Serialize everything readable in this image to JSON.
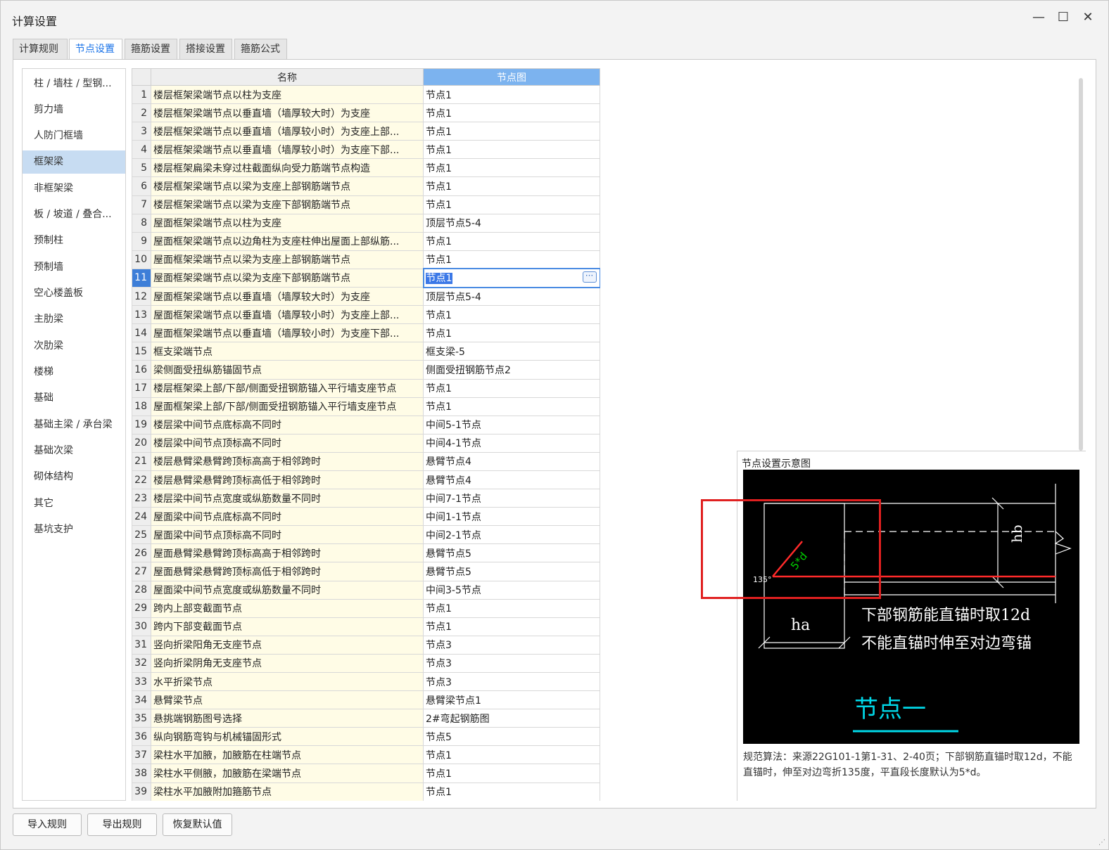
{
  "window": {
    "title": "计算设置"
  },
  "tabs": [
    {
      "label": "计算规则"
    },
    {
      "label": "节点设置"
    },
    {
      "label": "箍筋设置"
    },
    {
      "label": "搭接设置"
    },
    {
      "label": "箍筋公式"
    }
  ],
  "sidebar": {
    "items": [
      {
        "label": "柱 / 墙柱 / 型钢..."
      },
      {
        "label": "剪力墙"
      },
      {
        "label": "人防门框墙"
      },
      {
        "label": "框架梁"
      },
      {
        "label": "非框架梁"
      },
      {
        "label": "板 / 坡道 / 叠合..."
      },
      {
        "label": "预制柱"
      },
      {
        "label": "预制墙"
      },
      {
        "label": "空心楼盖板"
      },
      {
        "label": "主肋梁"
      },
      {
        "label": "次肋梁"
      },
      {
        "label": "楼梯"
      },
      {
        "label": "基础"
      },
      {
        "label": "基础主梁 / 承台梁"
      },
      {
        "label": "基础次梁"
      },
      {
        "label": "砌体结构"
      },
      {
        "label": "其它"
      },
      {
        "label": "基坑支护"
      }
    ]
  },
  "grid": {
    "columns": {
      "name": "名称",
      "node": "节点图"
    },
    "rows": [
      {
        "num": "1",
        "name": "楼层框架梁端节点以柱为支座",
        "value": "节点1"
      },
      {
        "num": "2",
        "name": "楼层框架梁端节点以垂直墙（墙厚较大时）为支座",
        "value": "节点1"
      },
      {
        "num": "3",
        "name": "楼层框架梁端节点以垂直墙（墙厚较小时）为支座上部...",
        "value": "节点1"
      },
      {
        "num": "4",
        "name": "楼层框架梁端节点以垂直墙（墙厚较小时）为支座下部...",
        "value": "节点1"
      },
      {
        "num": "5",
        "name": "楼层框架扁梁未穿过柱截面纵向受力筋端节点构造",
        "value": "节点1"
      },
      {
        "num": "6",
        "name": "楼层框架梁端节点以梁为支座上部钢筋端节点",
        "value": "节点1"
      },
      {
        "num": "7",
        "name": "楼层框架梁端节点以梁为支座下部钢筋端节点",
        "value": "节点1"
      },
      {
        "num": "8",
        "name": "屋面框架梁端节点以柱为支座",
        "value": "顶层节点5-4"
      },
      {
        "num": "9",
        "name": "屋面框架梁端节点以边角柱为支座柱伸出屋面上部纵筋...",
        "value": "节点1"
      },
      {
        "num": "10",
        "name": "屋面框架梁端节点以梁为支座上部钢筋端节点",
        "value": "节点1"
      },
      {
        "num": "11",
        "name": "屋面框架梁端节点以梁为支座下部钢筋端节点",
        "value": "节点1"
      },
      {
        "num": "12",
        "name": "屋面框架梁端节点以垂直墙（墙厚较大时）为支座",
        "value": "顶层节点5-4"
      },
      {
        "num": "13",
        "name": "屋面框架梁端节点以垂直墙（墙厚较小时）为支座上部...",
        "value": "节点1"
      },
      {
        "num": "14",
        "name": "屋面框架梁端节点以垂直墙（墙厚较小时）为支座下部...",
        "value": "节点1"
      },
      {
        "num": "15",
        "name": "框支梁端节点",
        "value": "框支梁-5"
      },
      {
        "num": "16",
        "name": "梁侧面受扭纵筋锚固节点",
        "value": "侧面受扭钢筋节点2"
      },
      {
        "num": "17",
        "name": "楼层框架梁上部/下部/侧面受扭钢筋锚入平行墙支座节点",
        "value": "节点1"
      },
      {
        "num": "18",
        "name": "屋面框架梁上部/下部/侧面受扭钢筋锚入平行墙支座节点",
        "value": "节点1"
      },
      {
        "num": "19",
        "name": "楼层梁中间节点底标高不同时",
        "value": "中间5-1节点"
      },
      {
        "num": "20",
        "name": "楼层梁中间节点顶标高不同时",
        "value": "中间4-1节点"
      },
      {
        "num": "21",
        "name": "楼层悬臂梁悬臂跨顶标高高于相邻跨时",
        "value": "悬臂节点4"
      },
      {
        "num": "22",
        "name": "楼层悬臂梁悬臂跨顶标高低于相邻跨时",
        "value": "悬臂节点4"
      },
      {
        "num": "23",
        "name": "楼层梁中间节点宽度或纵筋数量不同时",
        "value": "中间7-1节点"
      },
      {
        "num": "24",
        "name": "屋面梁中间节点底标高不同时",
        "value": "中间1-1节点"
      },
      {
        "num": "25",
        "name": "屋面梁中间节点顶标高不同时",
        "value": "中间2-1节点"
      },
      {
        "num": "26",
        "name": "屋面悬臂梁悬臂跨顶标高高于相邻跨时",
        "value": "悬臂节点5"
      },
      {
        "num": "27",
        "name": "屋面悬臂梁悬臂跨顶标高低于相邻跨时",
        "value": "悬臂节点5"
      },
      {
        "num": "28",
        "name": "屋面梁中间节点宽度或纵筋数量不同时",
        "value": "中间3-5节点"
      },
      {
        "num": "29",
        "name": "跨内上部变截面节点",
        "value": "节点1"
      },
      {
        "num": "30",
        "name": "跨内下部变截面节点",
        "value": "节点1"
      },
      {
        "num": "31",
        "name": "竖向折梁阳角无支座节点",
        "value": "节点3"
      },
      {
        "num": "32",
        "name": "竖向折梁阴角无支座节点",
        "value": "节点3"
      },
      {
        "num": "33",
        "name": "水平折梁节点",
        "value": "节点3"
      },
      {
        "num": "34",
        "name": "悬臂梁节点",
        "value": "悬臂梁节点1"
      },
      {
        "num": "35",
        "name": "悬挑端钢筋图号选择",
        "value": "2#弯起钢筋图"
      },
      {
        "num": "36",
        "name": "纵向钢筋弯钩与机械锚固形式",
        "value": "节点5"
      },
      {
        "num": "37",
        "name": "梁柱水平加腋，加腋筋在柱端节点",
        "value": "节点1"
      },
      {
        "num": "38",
        "name": "梁柱水平侧腋，加腋筋在梁端节点",
        "value": "节点1"
      },
      {
        "num": "39",
        "name": "梁柱水平加腋附加箍筋节点",
        "value": "节点1"
      }
    ]
  },
  "preview": {
    "title": "节点设置示意图",
    "diagram": {
      "label_angle": "135°",
      "label_5d": "5*d",
      "label_hb": "hb",
      "label_ha": "ha",
      "text_line1": "下部钢筋能直锚时取12d",
      "text_line2": "不能直锚时伸至对边弯锚",
      "node_title": "节点一"
    },
    "description": "规范算法：来源22G101-1第1-31、2-40页；下部钢筋直锚时取12d，不能直锚时，伸至对边弯折135度，平直段长度默认为5*d。"
  },
  "buttons": {
    "import": "导入规则",
    "export": "导出规则",
    "restore": "恢复默认值"
  },
  "colors": {
    "accent": "#1a73e8",
    "selection": "#3d7ed8",
    "highlight_box": "#e02020"
  }
}
